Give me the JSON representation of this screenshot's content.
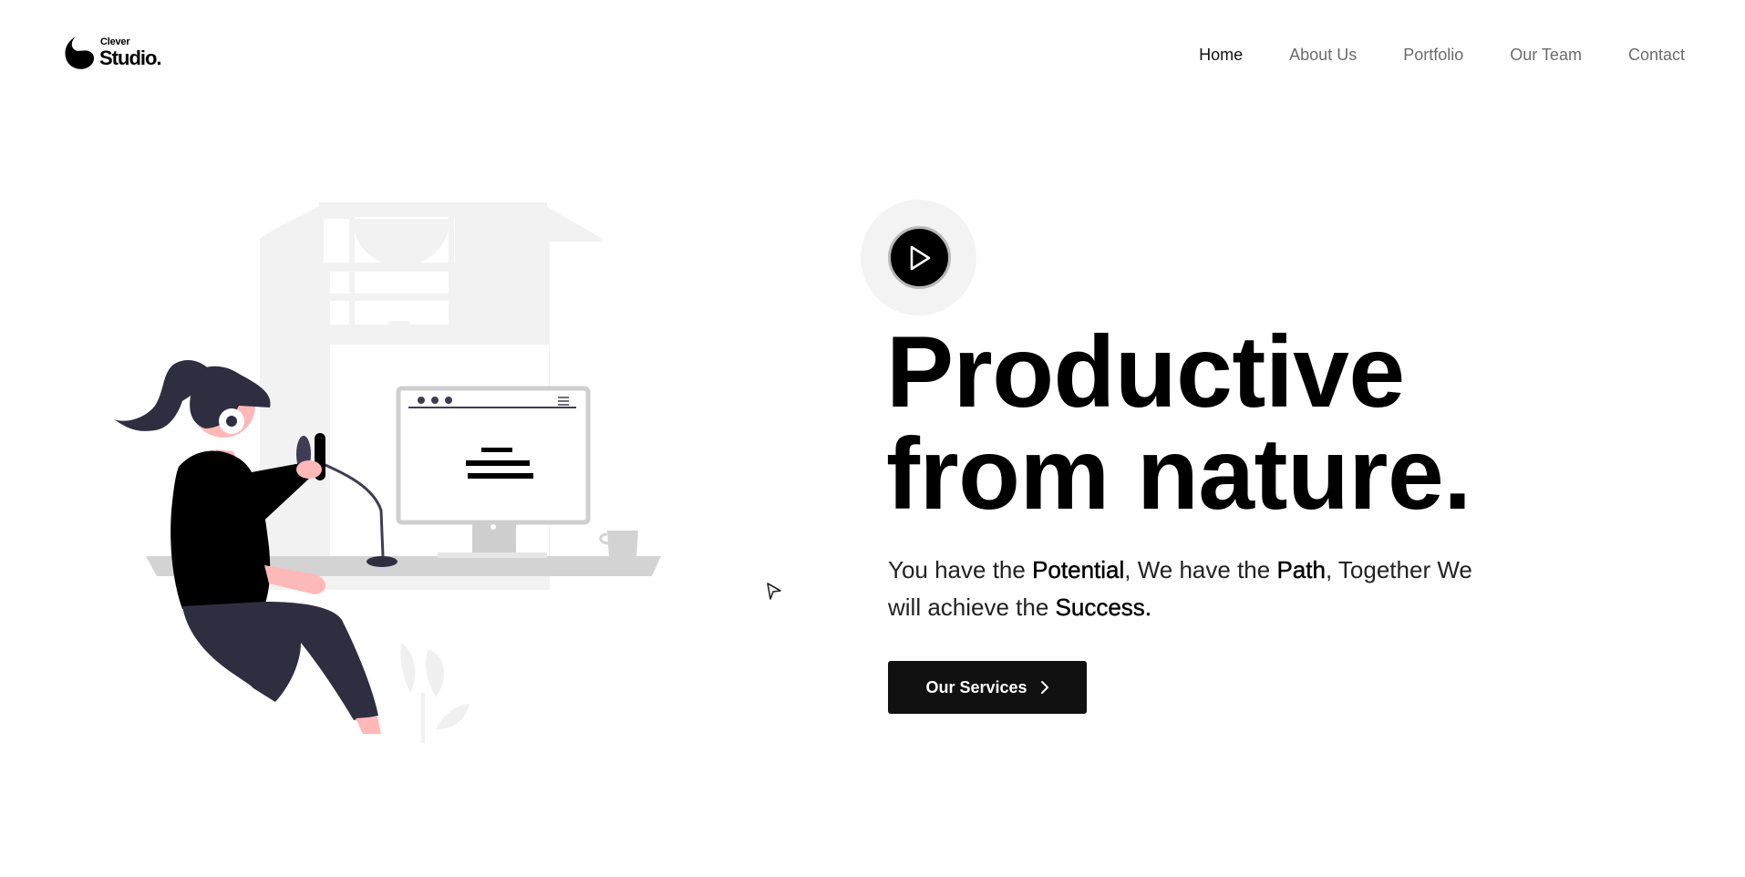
{
  "header": {
    "logo": {
      "small": "Clever",
      "big": "Studio."
    },
    "nav": [
      {
        "label": "Home",
        "active": true
      },
      {
        "label": "About Us",
        "active": false
      },
      {
        "label": "Portfolio",
        "active": false
      },
      {
        "label": "Our Team",
        "active": false
      },
      {
        "label": "Contact",
        "active": false
      }
    ]
  },
  "hero": {
    "play_icon": "play-icon",
    "title_line1": "Productive",
    "title_line2": "from nature.",
    "subtitle": {
      "p1": "You have the ",
      "b1": "Potential",
      "p2": ", We have the ",
      "b2": "Path",
      "p3": ", Together We will achieve the ",
      "b3": "Success."
    },
    "cta": {
      "label": "Our Services",
      "icon": "chevron-right-icon"
    }
  },
  "colors": {
    "text": "#000000",
    "nav_inactive": "#6b6b6b",
    "button_bg": "#111111",
    "play_ring": "#f3f3f3",
    "illustration_gray": "#e6e6e6",
    "illustration_dark": "#2f2e41",
    "skin": "#ffb8b8"
  }
}
